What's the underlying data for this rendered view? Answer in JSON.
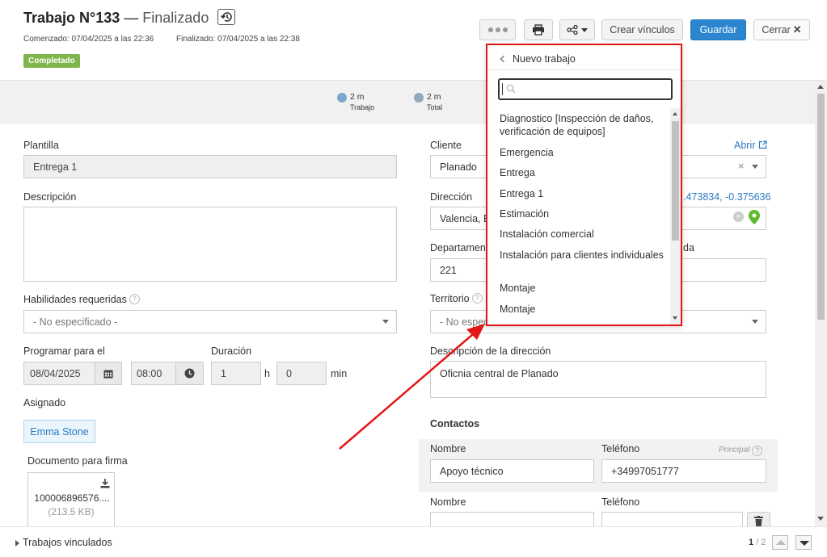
{
  "header": {
    "title": "Trabajo N°133",
    "separator": "—",
    "status": "Finalizado",
    "started": "Comenzado: 07/04/2025 a las 22:36",
    "finished": "Finalizado: 07/04/2025 a las 22:38",
    "badge": "Completado",
    "badge_color": "#7fb54a"
  },
  "toolbar": {
    "more_icon": "ellipsis-icon",
    "print_icon": "printer-icon",
    "share_icon": "share-icon",
    "create_links_label": "Crear vínculos",
    "save_label": "Guardar",
    "close_label": "Cerrar",
    "close_icon": "x-icon",
    "accent": "#2b86cf"
  },
  "timebar": {
    "work_value": "2 m",
    "work_label": "Trabajo",
    "total_value": "2 m",
    "total_label": "Total"
  },
  "form": {
    "template_label": "Plantilla",
    "template_value": "Entrega 1",
    "description_label": "Descripción",
    "skills_label": "Habilidades requeridas",
    "skills_value": "- No especificado -",
    "schedule_label": "Programar para el",
    "date_value": "08/04/2025",
    "time_value": "08:00",
    "duration_label": "Duración",
    "duration_hours": "1",
    "hours_unit": "h",
    "duration_minutes": "0",
    "minutes_unit": "min",
    "assigned_label": "Asignado",
    "assigned_value": "Emma Stone",
    "document_label": "Documento para firma",
    "document_name": "100006896576....",
    "document_size": "(213.5 KB)",
    "client_label": "Cliente",
    "client_open_link": "Abrir",
    "client_value": "Planado",
    "address_label": "Dirección",
    "address_coords": ".473834, -0.375636",
    "address_value": "Valencia, E",
    "apartment_label": "Departamen",
    "apartment_value": "221",
    "floor_label_partial": "da",
    "territory_label": "Territorio",
    "territory_value": "- No espec",
    "address_desc_label": "Descripción de la dirección",
    "address_desc_value": "Oficnia central de Planado",
    "contacts_title": "Contactos",
    "contacts_name_label": "Nombre",
    "contacts_phone_label": "Teléfono",
    "contacts_principal_label": "Principal",
    "contacts": [
      {
        "name": "Apoyo técnico",
        "phone": "+34997051777"
      },
      {
        "name": "",
        "phone": ""
      }
    ]
  },
  "footer": {
    "linked_jobs_label": "Trabajos vinculados",
    "page_current": "1",
    "page_total": "/ 2"
  },
  "dropdown": {
    "title": "Nuevo trabajo",
    "search_placeholder": "",
    "items": [
      "Diagnostico [Inspección de daños, verificación de equipos]",
      "Emergencia",
      "Entrega",
      "Entrega 1",
      "Estimación",
      "Instalación comercial",
      "Instalación para clientes individuales",
      "Montaje",
      "Montaje"
    ],
    "highlight_color": "#e41515"
  }
}
